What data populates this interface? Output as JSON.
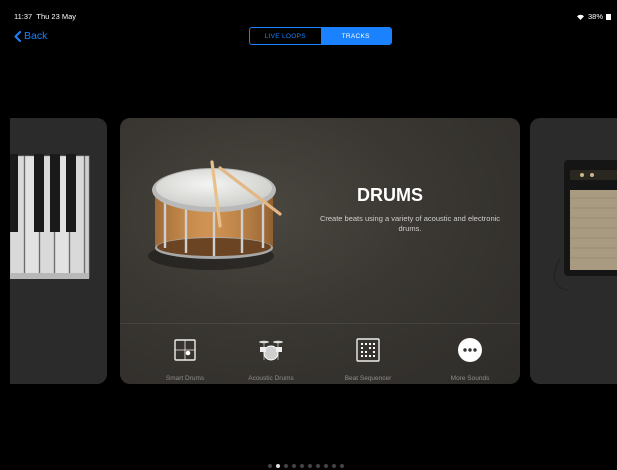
{
  "status": {
    "time": "11:37",
    "date": "Thu 23 May",
    "battery": "38%"
  },
  "nav": {
    "back_label": "Back"
  },
  "segments": [
    {
      "label": "LIVE LOOPS",
      "active": false
    },
    {
      "label": "TRACKS",
      "active": true
    }
  ],
  "instrument": {
    "title": "DRUMS",
    "description": "Create beats using a variety of acoustic and electronic drums."
  },
  "options": [
    {
      "label": "Smart Drums",
      "icon": "smart-drums-icon"
    },
    {
      "label": "Acoustic Drums",
      "icon": "drum-kit-icon"
    },
    {
      "label": "Beat Sequencer",
      "icon": "beat-sequencer-icon"
    },
    {
      "label": "More Sounds",
      "icon": "more-icon"
    }
  ],
  "pager": {
    "count": 10,
    "current": 1
  },
  "colors": {
    "accent": "#1a82ff",
    "background": "#000000",
    "card": "#3a3732"
  }
}
